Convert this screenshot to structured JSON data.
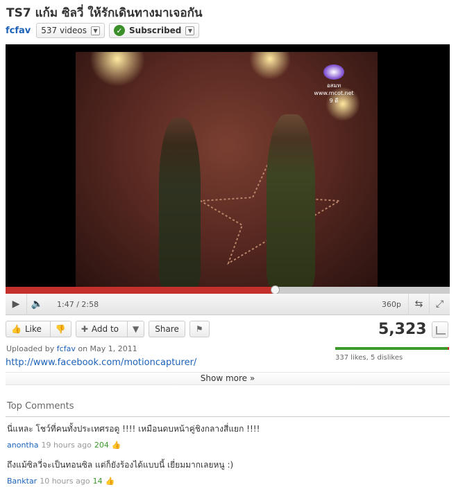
{
  "video": {
    "title": "TS7 แก้ม ซิลวี่ ให้รักเดินทางมาเจอกัน",
    "logo_text": "อสมท",
    "logo_url": "www.mcot.net",
    "logo_channel": "9 ดี"
  },
  "channel": {
    "name": "fcfav",
    "videos_label": "537 videos",
    "subscribed_label": "Subscribed"
  },
  "player": {
    "progress": 0.607,
    "time": "1:47 / 2:58",
    "quality": "360p"
  },
  "actions": {
    "like_label": "Like",
    "add_to_label": "Add to",
    "share_label": "Share"
  },
  "stats": {
    "view_count": "5,323",
    "likes_text": "337 likes, 5 dislikes",
    "like_ratio": 0.985
  },
  "upload": {
    "prefix": "Uploaded by",
    "user": "fcfav",
    "date_text": "on May 1, 2011",
    "link": "http://www.facebook.com/motioncapturer/"
  },
  "show_more_label": "Show more",
  "comments": {
    "heading": "Top Comments",
    "items": [
      {
        "text": "นี่แหละ โชว์ที่คนทั้งประเทศรอดู !!!! เหมือนดบหน้าคู่ชิงกลางสี่แยก !!!!",
        "author": "anontha",
        "time": "19 hours ago",
        "votes": "204"
      },
      {
        "text": "ถึงแม้ซิลวี่จะเป็นทอนซิล แต่ก็ยังร้องได้แบบนี้ เยี่ยมมากเลยหนู :)",
        "author": "Banktar",
        "time": "10 hours ago",
        "votes": "14"
      }
    ]
  },
  "colors": {
    "accent_red": "#c4302b",
    "link_blue": "#1c62b9",
    "like_green": "#3b9a2a"
  },
  "icons": [
    "play-icon",
    "volume-icon",
    "popout-icon",
    "fullscreen-icon",
    "thumbs-up-icon",
    "thumbs-down-icon",
    "plus-icon",
    "flag-icon",
    "chevron-down-icon",
    "checkmark-icon",
    "stats-icon"
  ]
}
